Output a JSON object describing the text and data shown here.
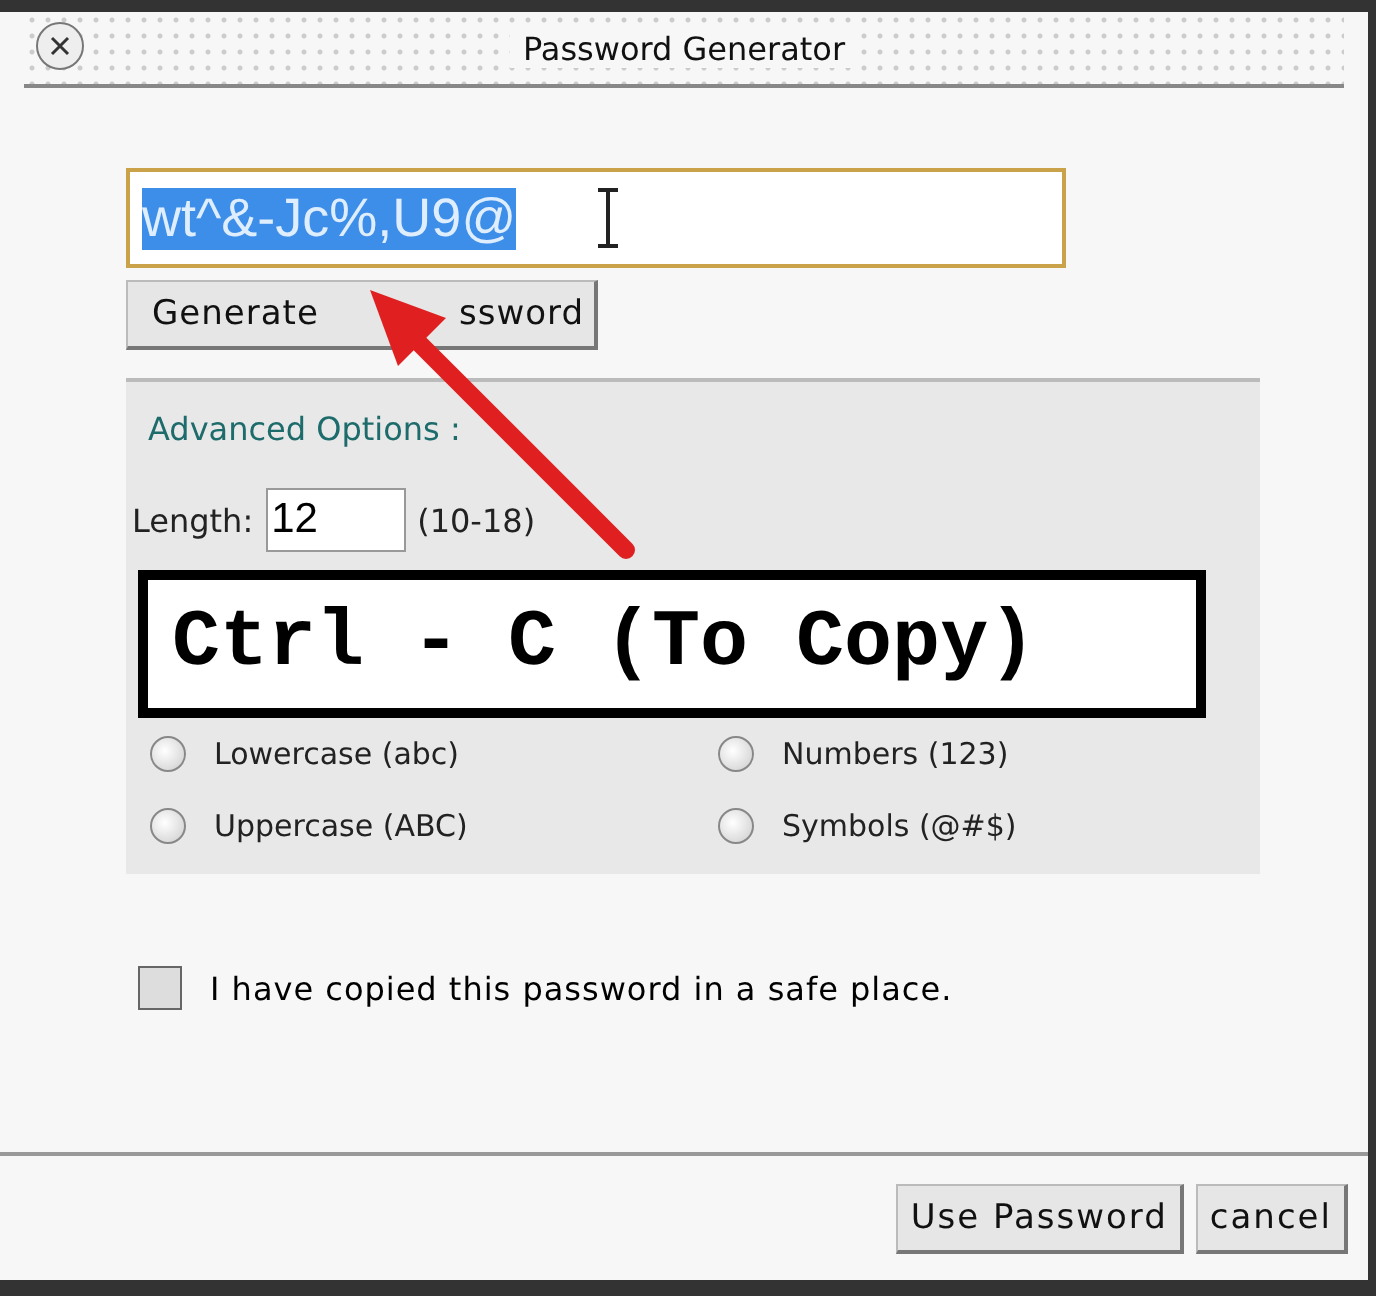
{
  "window": {
    "title": "Password Generator"
  },
  "password_field": {
    "value": "wt^&-Jc%,U9@",
    "text_selected": true
  },
  "generate_button": {
    "label_parts": [
      "Generate",
      "ssword"
    ]
  },
  "advanced": {
    "link": "Advanced Options :",
    "length_label": "Length:",
    "length_value": "12",
    "length_hint": "(10-18)",
    "options": [
      {
        "label": "Lowercase (abc)",
        "checked": false
      },
      {
        "label": "Numbers (123)",
        "checked": false
      },
      {
        "label": "Uppercase (ABC)",
        "checked": false
      },
      {
        "label": "Symbols (@#$)",
        "checked": false
      }
    ]
  },
  "confirm": {
    "label": "I have copied this password in a safe place.",
    "checked": false
  },
  "buttons": [
    {
      "label": "Use Password"
    },
    {
      "label": "cancel"
    }
  ],
  "annotation": {
    "text": "Ctrl - C (To Copy)"
  }
}
